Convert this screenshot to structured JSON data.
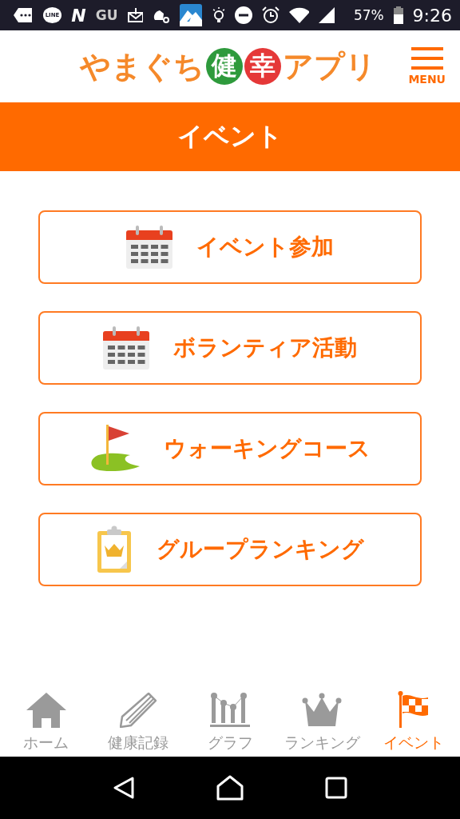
{
  "status_bar": {
    "items": [
      {
        "kind": "more"
      },
      {
        "kind": "line",
        "text": "LINE"
      },
      {
        "kind": "letter",
        "text": "N"
      },
      {
        "kind": "letter",
        "text": "GU"
      },
      {
        "kind": "mail"
      },
      {
        "kind": "cloud"
      },
      {
        "kind": "app"
      },
      {
        "kind": "bulb"
      },
      {
        "kind": "dnd"
      },
      {
        "kind": "alarm"
      },
      {
        "kind": "wifi"
      },
      {
        "kind": "signal"
      }
    ],
    "battery": "57%",
    "time": "9:26"
  },
  "header": {
    "logo": [
      {
        "kind": "plain",
        "text": "やまぐち"
      },
      {
        "kind": "badge",
        "text": "健",
        "color": "#2e9a3c"
      },
      {
        "kind": "badge",
        "text": "幸",
        "color": "#e53838"
      },
      {
        "kind": "plain",
        "text": "アプリ"
      }
    ],
    "menu_label": "MENU"
  },
  "title": "イベント",
  "buttons": [
    {
      "kind": "calendar",
      "label": "イベント参加"
    },
    {
      "kind": "calendar",
      "label": "ボランティア活動"
    },
    {
      "kind": "golf",
      "label": "ウォーキングコース"
    },
    {
      "kind": "clipboard",
      "label": "グループランキング"
    }
  ],
  "tabs": [
    {
      "kind": "home",
      "label": "ホーム",
      "selected": false
    },
    {
      "kind": "pencil",
      "label": "健康記録",
      "selected": false
    },
    {
      "kind": "chart",
      "label": "グラフ",
      "selected": false
    },
    {
      "kind": "crown",
      "label": "ランキング",
      "selected": false
    },
    {
      "kind": "flag",
      "label": "イベント",
      "selected": true
    }
  ]
}
